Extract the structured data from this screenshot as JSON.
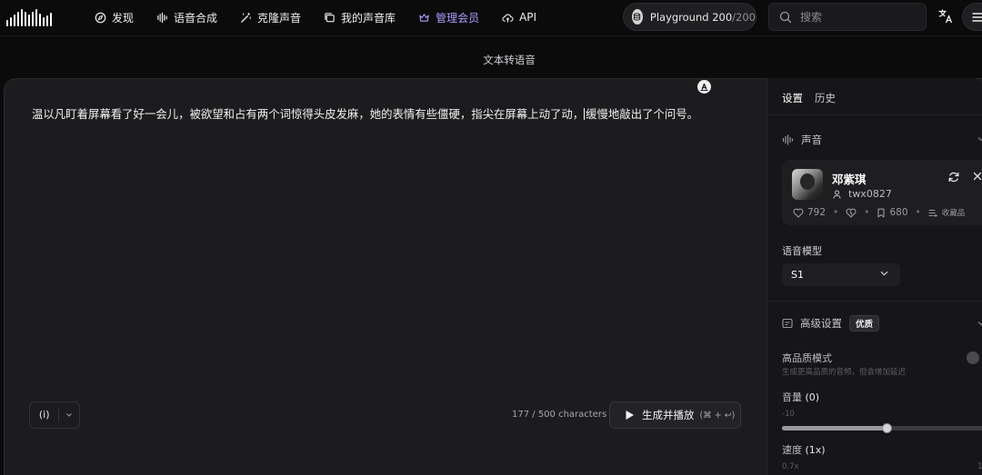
{
  "nav": {
    "items": [
      {
        "label": "发现",
        "icon": "compass-icon"
      },
      {
        "label": "语音合成",
        "icon": "waveform-icon"
      },
      {
        "label": "克隆声音",
        "icon": "magic-wand-icon"
      },
      {
        "label": "我的声音库",
        "icon": "library-icon"
      },
      {
        "label": "管理会员",
        "icon": "crown-icon"
      },
      {
        "label": "API",
        "icon": "cloud-icon"
      }
    ],
    "playground_label": "Playground",
    "playground_used": "200",
    "playground_total": "/200",
    "search_placeholder": "搜索",
    "vip_color": "#a99cff"
  },
  "page": {
    "subtitle": "文本转语音"
  },
  "editor": {
    "text_before_caret": "温以凡盯着屏幕看了好一会儿，被欲望和占有两个词惊得头皮发麻，她的表情有些僵硬，指尖在屏幕上动了动，",
    "text_after_caret": "缓慢地敲出了个问号。",
    "emotion_label": "(i)",
    "char_count": "177 / 500 characters",
    "generate_label": "生成并播放",
    "generate_shortcut": "(⌘ + ↩)"
  },
  "panel": {
    "tabs": [
      {
        "label": "设置",
        "active": true
      },
      {
        "label": "历史",
        "active": false
      }
    ],
    "voice_section_title": "声音",
    "voice": {
      "name": "邓紫琪",
      "username": "twx0827",
      "likes": "792",
      "bookmarks": "680",
      "collect_label": "收藏品"
    },
    "model_label": "语音模型",
    "model_value": "S1",
    "advanced_title": "高级设置",
    "advanced_badge": "优质",
    "hq_label": "高品质模式",
    "hq_hint": "生成更高品质的音频，但会增加延迟",
    "hq_enabled": false,
    "volume_label": "音量",
    "volume_value": "(0)",
    "volume_min": "-10",
    "volume_level_fraction": 0.5,
    "speed_label": "速度",
    "speed_value": "(1x)",
    "speed_min": "0.7x",
    "speed_max": "1"
  }
}
